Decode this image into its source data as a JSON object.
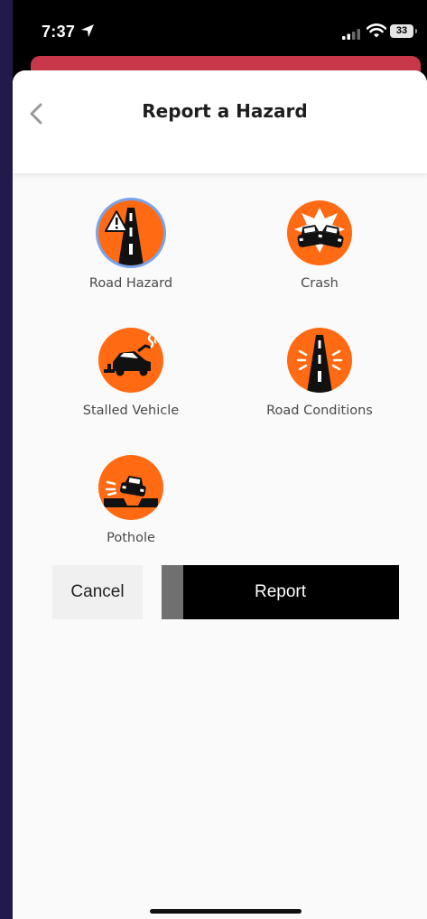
{
  "status_bar": {
    "time": "7:37",
    "battery": "33"
  },
  "header": {
    "title": "Report a Hazard"
  },
  "hazards": [
    {
      "label": "Road Hazard",
      "icon": "road-hazard-icon",
      "selected": true
    },
    {
      "label": "Crash",
      "icon": "crash-icon",
      "selected": false
    },
    {
      "label": "Stalled Vehicle",
      "icon": "stalled-vehicle-icon",
      "selected": false
    },
    {
      "label": "Road Conditions",
      "icon": "road-conditions-icon",
      "selected": false
    },
    {
      "label": "Pothole",
      "icon": "pothole-icon",
      "selected": false
    }
  ],
  "actions": {
    "cancel_label": "Cancel",
    "report_label": "Report",
    "report_progress": 0.09
  },
  "colors": {
    "accent": "#ff6a13",
    "banner": "#c8384a",
    "selected_ring": "#7aa3e8"
  }
}
